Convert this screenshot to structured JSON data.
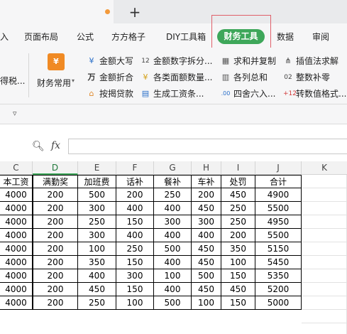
{
  "tabstrip": {
    "new_tab_icon": "plus-icon"
  },
  "menu": {
    "items": [
      "入",
      "页面布局",
      "公式",
      "方方格子",
      "DIY工具箱",
      "财务工具",
      "数据",
      "审阅"
    ],
    "active": "财务工具",
    "active_color": "#3ea75a",
    "highlight_color": "#e0606a"
  },
  "ribbon": {
    "left_cut": "得税...",
    "big_button": "财务常用",
    "col1": [
      "金额大写",
      "金额折合",
      "按揭贷款"
    ],
    "col2": [
      "金额数字拆分...",
      "各类面额数量...",
      "生成工资条..."
    ],
    "col3": [
      "求和并复制",
      "各列总和",
      "四舍六入..."
    ],
    "col4": [
      "插值法求解",
      "整数补零",
      "转数值格式..."
    ],
    "icons": {
      "big": "finance-icon",
      "col1": [
        "rmb-uppercase-icon",
        "wan-convert-icon",
        "house-loan-icon"
      ],
      "col2": [
        "number-split-icon",
        "denomination-icon",
        "payslip-icon"
      ],
      "col3": [
        "sum-copy-icon",
        "column-sum-icon",
        "round-icon"
      ],
      "col4": [
        "interpolation-icon",
        "zero-pad-icon",
        "to-number-icon"
      ]
    }
  },
  "quickbar": {
    "arrow": "▿"
  },
  "formula_bar": {
    "fx": "fx",
    "value": ""
  },
  "sheet": {
    "columns": [
      "C",
      "D",
      "E",
      "F",
      "G",
      "H",
      "I",
      "J",
      "K"
    ],
    "header_row": [
      "本工资",
      "满勤奖",
      "加班费",
      "话补",
      "餐补",
      "车补",
      "处罚",
      "合计"
    ],
    "rows": [
      [
        "4000",
        "200",
        "500",
        "200",
        "250",
        "200",
        "450",
        "4900"
      ],
      [
        "4000",
        "200",
        "300",
        "400",
        "400",
        "450",
        "250",
        "5500"
      ],
      [
        "4000",
        "200",
        "250",
        "150",
        "300",
        "300",
        "250",
        "4950"
      ],
      [
        "4000",
        "200",
        "300",
        "400",
        "400",
        "400",
        "200",
        "5500"
      ],
      [
        "4000",
        "200",
        "100",
        "250",
        "500",
        "450",
        "350",
        "5150"
      ],
      [
        "4000",
        "200",
        "350",
        "150",
        "400",
        "450",
        "100",
        "5450"
      ],
      [
        "4000",
        "200",
        "400",
        "300",
        "100",
        "500",
        "150",
        "5350"
      ],
      [
        "4000",
        "200",
        "450",
        "150",
        "400",
        "450",
        "450",
        "5200"
      ],
      [
        "4000",
        "200",
        "250",
        "100",
        "500",
        "100",
        "150",
        "5000"
      ]
    ]
  }
}
